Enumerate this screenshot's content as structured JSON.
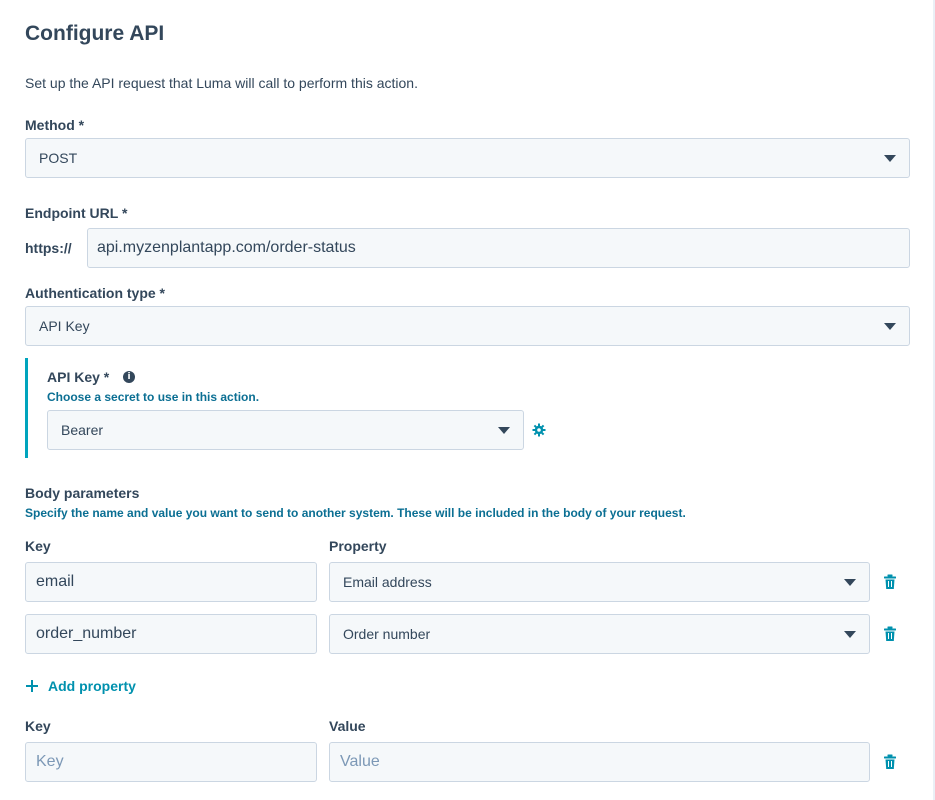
{
  "title": "Configure API",
  "description": "Set up the API request that Luma will call to perform this action.",
  "method": {
    "label": "Method *",
    "value": "POST"
  },
  "endpoint": {
    "label": "Endpoint URL *",
    "prefix": "https://",
    "value": "api.myzenplantapp.com/order-status"
  },
  "auth": {
    "label": "Authentication type *",
    "value": "API Key"
  },
  "api_key": {
    "label": "API Key *",
    "help": "Choose a secret to use in this action.",
    "value": "Bearer"
  },
  "body": {
    "label": "Body parameters",
    "help": "Specify the name and value you want to send to another system. These will be included in the body of your request.",
    "key_header": "Key",
    "property_header": "Property",
    "rows": [
      {
        "key": "email",
        "property": "Email address"
      },
      {
        "key": "order_number",
        "property": "Order number"
      }
    ],
    "add_label": "Add property",
    "static_key_header": "Key",
    "static_value_header": "Value",
    "key_placeholder": "Key",
    "value_placeholder": "Value"
  },
  "colors": {
    "accent": "#0091ae",
    "text": "#33475b",
    "field_bg": "#f5f8fa",
    "border": "#cbd6e2"
  }
}
